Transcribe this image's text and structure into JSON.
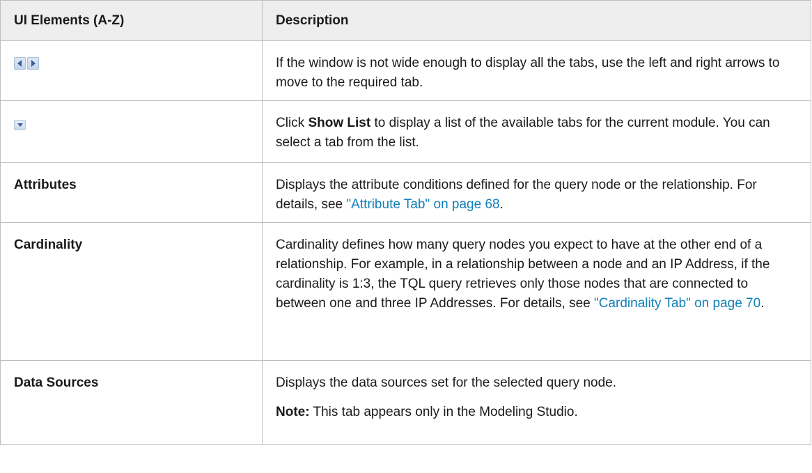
{
  "headers": {
    "ui_elements": "UI Elements (A-Z)",
    "description": "Description"
  },
  "icons": {
    "arrows": "left-right-arrows-icon",
    "show_list": "show-list-dropdown-icon",
    "icon_color": "#3a5f94"
  },
  "rows": [
    {
      "desc": "If the window is not wide enough to display all the tabs, use the left and right arrows to move to the required tab."
    },
    {
      "desc_pre": "Click ",
      "desc_bold": "Show List",
      "desc_post": " to display a list of the available tabs for the current module. You can select a tab from the list."
    },
    {
      "element": "Attributes",
      "desc_pre": "Displays the attribute conditions defined for the query node or the relationship. For details, see ",
      "link": "\"Attribute Tab\" on page 68",
      "desc_post": "."
    },
    {
      "element": "Cardinality",
      "desc_pre": "Cardinality defines how many query nodes you expect to have at the other end of a relationship. For example, in a relationship between a node and an IP Address, if the cardinality is 1:3, the TQL query retrieves only those nodes that are connected to between one and three IP Addresses. For details, see ",
      "link": "\"Cardinality Tab\" on page 70",
      "desc_post": "."
    },
    {
      "element": "Data Sources",
      "desc": "Displays the data sources set for the selected query node.",
      "note_label": "Note:",
      "note_text": " This tab appears only in the Modeling Studio."
    }
  ]
}
